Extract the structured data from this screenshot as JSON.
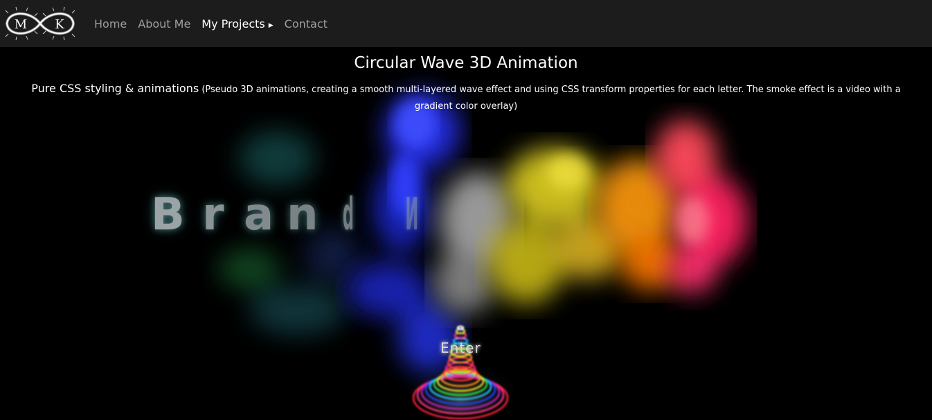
{
  "nav": {
    "logo_text": "M K",
    "items": [
      {
        "label": "Home"
      },
      {
        "label": "About Me"
      },
      {
        "label": "My Projects"
      },
      {
        "label": "Contact"
      }
    ]
  },
  "main": {
    "title": "Circular Wave 3D Animation",
    "subtitle_lead": "Pure CSS styling & animations",
    "subtitle_detail": " (Pseudo 3D animations, creating a smooth multi-layered wave effect and using CSS transform properties for each letter. The smoke effect is a video with a gradient color overlay)",
    "brand_letters": [
      "B",
      "r",
      "a",
      "n",
      "d",
      "N"
    ],
    "enter_label": "Enter"
  },
  "colors": {
    "navbar_bg": "#1c1c1c",
    "nav_inactive": "#9e9e9e",
    "nav_active": "#ffffff",
    "smoke_gradient": [
      "#1e6b6b",
      "#1a8a3a",
      "#2a3cff",
      "#c8c8c8",
      "#e0d020",
      "#ff8a00",
      "#ff2060"
    ]
  }
}
